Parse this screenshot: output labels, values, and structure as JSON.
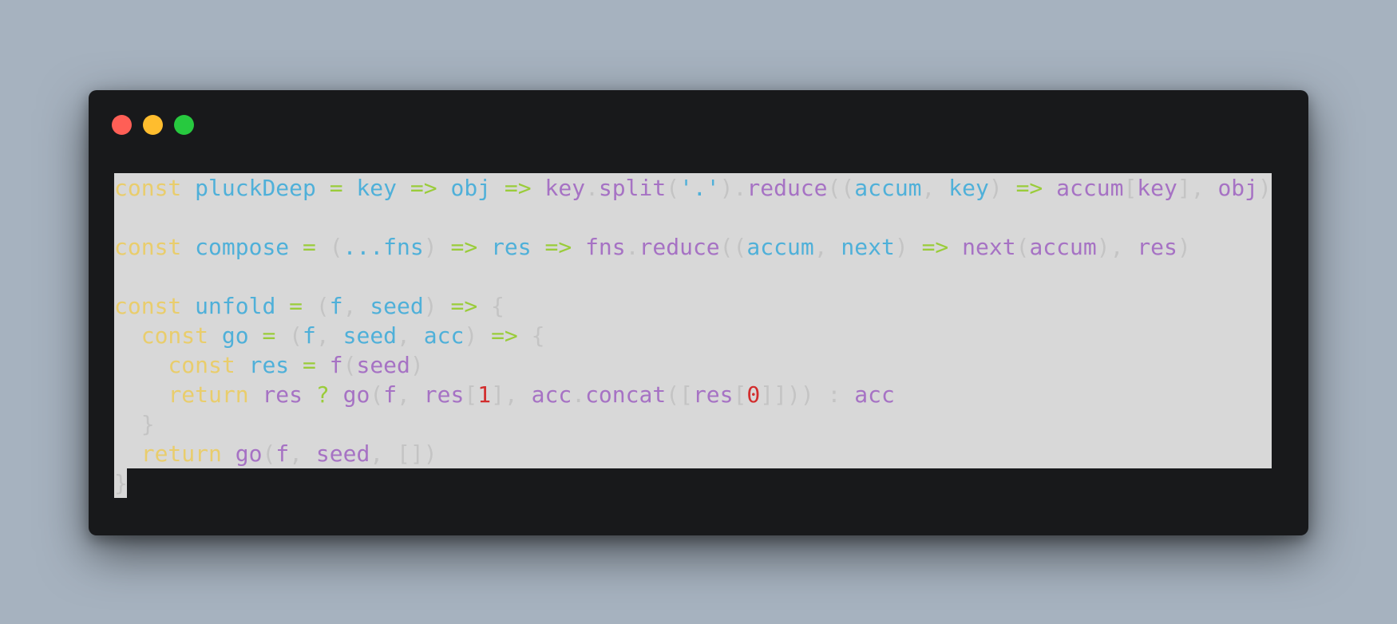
{
  "window_controls": {
    "close_color": "#ff5f56",
    "minimize_color": "#ffbd2e",
    "maximize_color": "#27c93f"
  },
  "colors": {
    "background": "#a6b2bf",
    "window": "#18191b",
    "selection": "#d8d8d8",
    "keyword": "#e9cd6c",
    "identifier": "#4fb0d9",
    "call": "#a672c4",
    "operator": "#9acc3a",
    "punctuation": "#c4c4c4",
    "number": "#d22d2d"
  },
  "code": {
    "lines": [
      [
        {
          "t": "const",
          "k": "kw"
        },
        {
          "t": " ",
          "k": "pn"
        },
        {
          "t": "pluckDeep",
          "k": "id"
        },
        {
          "t": " ",
          "k": "pn"
        },
        {
          "t": "=",
          "k": "op"
        },
        {
          "t": " ",
          "k": "pn"
        },
        {
          "t": "key",
          "k": "id"
        },
        {
          "t": " ",
          "k": "pn"
        },
        {
          "t": "=>",
          "k": "op"
        },
        {
          "t": " ",
          "k": "pn"
        },
        {
          "t": "obj",
          "k": "id"
        },
        {
          "t": " ",
          "k": "pn"
        },
        {
          "t": "=>",
          "k": "op"
        },
        {
          "t": " ",
          "k": "pn"
        },
        {
          "t": "key",
          "k": "call"
        },
        {
          "t": ".",
          "k": "pn"
        },
        {
          "t": "split",
          "k": "call"
        },
        {
          "t": "(",
          "k": "pn"
        },
        {
          "t": "'.'",
          "k": "str"
        },
        {
          "t": ").",
          "k": "pn"
        },
        {
          "t": "reduce",
          "k": "call"
        },
        {
          "t": "((",
          "k": "pn"
        },
        {
          "t": "accum",
          "k": "id"
        },
        {
          "t": ", ",
          "k": "pn"
        },
        {
          "t": "key",
          "k": "id"
        },
        {
          "t": ") ",
          "k": "pn"
        },
        {
          "t": "=>",
          "k": "op"
        },
        {
          "t": " ",
          "k": "pn"
        },
        {
          "t": "accum",
          "k": "call"
        },
        {
          "t": "[",
          "k": "pn"
        },
        {
          "t": "key",
          "k": "call"
        },
        {
          "t": "], ",
          "k": "pn"
        },
        {
          "t": "obj",
          "k": "call"
        },
        {
          "t": ")",
          "k": "pn"
        }
      ],
      [],
      [
        {
          "t": "const",
          "k": "kw"
        },
        {
          "t": " ",
          "k": "pn"
        },
        {
          "t": "compose",
          "k": "id"
        },
        {
          "t": " ",
          "k": "pn"
        },
        {
          "t": "=",
          "k": "op"
        },
        {
          "t": " (",
          "k": "pn"
        },
        {
          "t": "...fns",
          "k": "id"
        },
        {
          "t": ") ",
          "k": "pn"
        },
        {
          "t": "=>",
          "k": "op"
        },
        {
          "t": " ",
          "k": "pn"
        },
        {
          "t": "res",
          "k": "id"
        },
        {
          "t": " ",
          "k": "pn"
        },
        {
          "t": "=>",
          "k": "op"
        },
        {
          "t": " ",
          "k": "pn"
        },
        {
          "t": "fns",
          "k": "call"
        },
        {
          "t": ".",
          "k": "pn"
        },
        {
          "t": "reduce",
          "k": "call"
        },
        {
          "t": "((",
          "k": "pn"
        },
        {
          "t": "accum",
          "k": "id"
        },
        {
          "t": ", ",
          "k": "pn"
        },
        {
          "t": "next",
          "k": "id"
        },
        {
          "t": ") ",
          "k": "pn"
        },
        {
          "t": "=>",
          "k": "op"
        },
        {
          "t": " ",
          "k": "pn"
        },
        {
          "t": "next",
          "k": "call"
        },
        {
          "t": "(",
          "k": "pn"
        },
        {
          "t": "accum",
          "k": "call"
        },
        {
          "t": "), ",
          "k": "pn"
        },
        {
          "t": "res",
          "k": "call"
        },
        {
          "t": ")",
          "k": "pn"
        }
      ],
      [],
      [
        {
          "t": "const",
          "k": "kw"
        },
        {
          "t": " ",
          "k": "pn"
        },
        {
          "t": "unfold",
          "k": "id"
        },
        {
          "t": " ",
          "k": "pn"
        },
        {
          "t": "=",
          "k": "op"
        },
        {
          "t": " (",
          "k": "pn"
        },
        {
          "t": "f",
          "k": "id"
        },
        {
          "t": ", ",
          "k": "pn"
        },
        {
          "t": "seed",
          "k": "id"
        },
        {
          "t": ") ",
          "k": "pn"
        },
        {
          "t": "=>",
          "k": "op"
        },
        {
          "t": " {",
          "k": "pn"
        }
      ],
      [
        {
          "t": "  ",
          "k": "pn"
        },
        {
          "t": "const",
          "k": "kw"
        },
        {
          "t": " ",
          "k": "pn"
        },
        {
          "t": "go",
          "k": "id"
        },
        {
          "t": " ",
          "k": "pn"
        },
        {
          "t": "=",
          "k": "op"
        },
        {
          "t": " (",
          "k": "pn"
        },
        {
          "t": "f",
          "k": "id"
        },
        {
          "t": ", ",
          "k": "pn"
        },
        {
          "t": "seed",
          "k": "id"
        },
        {
          "t": ", ",
          "k": "pn"
        },
        {
          "t": "acc",
          "k": "id"
        },
        {
          "t": ") ",
          "k": "pn"
        },
        {
          "t": "=>",
          "k": "op"
        },
        {
          "t": " {",
          "k": "pn"
        }
      ],
      [
        {
          "t": "    ",
          "k": "pn"
        },
        {
          "t": "const",
          "k": "kw"
        },
        {
          "t": " ",
          "k": "pn"
        },
        {
          "t": "res",
          "k": "id"
        },
        {
          "t": " ",
          "k": "pn"
        },
        {
          "t": "=",
          "k": "op"
        },
        {
          "t": " ",
          "k": "pn"
        },
        {
          "t": "f",
          "k": "call"
        },
        {
          "t": "(",
          "k": "pn"
        },
        {
          "t": "seed",
          "k": "call"
        },
        {
          "t": ")",
          "k": "pn"
        }
      ],
      [
        {
          "t": "    ",
          "k": "pn"
        },
        {
          "t": "return",
          "k": "kw"
        },
        {
          "t": " ",
          "k": "pn"
        },
        {
          "t": "res",
          "k": "call"
        },
        {
          "t": " ",
          "k": "pn"
        },
        {
          "t": "?",
          "k": "op"
        },
        {
          "t": " ",
          "k": "pn"
        },
        {
          "t": "go",
          "k": "call"
        },
        {
          "t": "(",
          "k": "pn"
        },
        {
          "t": "f",
          "k": "call"
        },
        {
          "t": ", ",
          "k": "pn"
        },
        {
          "t": "res",
          "k": "call"
        },
        {
          "t": "[",
          "k": "pn"
        },
        {
          "t": "1",
          "k": "num"
        },
        {
          "t": "], ",
          "k": "pn"
        },
        {
          "t": "acc",
          "k": "call"
        },
        {
          "t": ".",
          "k": "pn"
        },
        {
          "t": "concat",
          "k": "call"
        },
        {
          "t": "([",
          "k": "pn"
        },
        {
          "t": "res",
          "k": "call"
        },
        {
          "t": "[",
          "k": "pn"
        },
        {
          "t": "0",
          "k": "num"
        },
        {
          "t": "]])) : ",
          "k": "pn"
        },
        {
          "t": "acc",
          "k": "call"
        }
      ],
      [
        {
          "t": "  }",
          "k": "pn"
        }
      ],
      [
        {
          "t": "  ",
          "k": "pn"
        },
        {
          "t": "return",
          "k": "kw"
        },
        {
          "t": " ",
          "k": "pn"
        },
        {
          "t": "go",
          "k": "call"
        },
        {
          "t": "(",
          "k": "pn"
        },
        {
          "t": "f",
          "k": "call"
        },
        {
          "t": ", ",
          "k": "pn"
        },
        {
          "t": "seed",
          "k": "call"
        },
        {
          "t": ", [])",
          "k": "pn"
        }
      ],
      [
        {
          "t": "}",
          "k": "pn"
        }
      ]
    ]
  }
}
